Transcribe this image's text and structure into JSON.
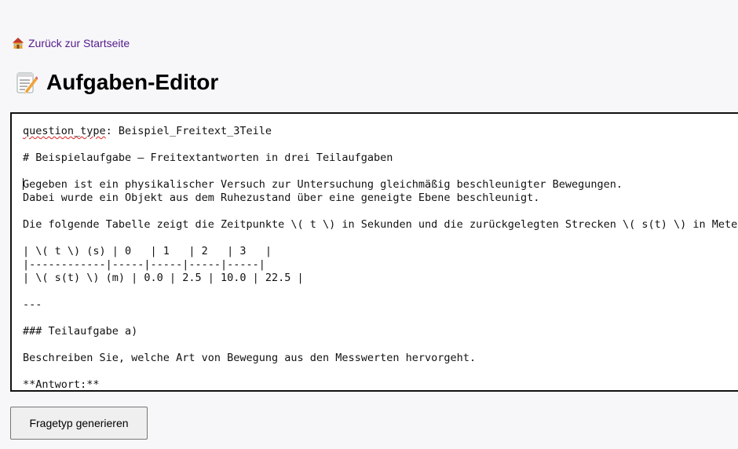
{
  "nav": {
    "back_link_label": "Zurück zur Startseite",
    "back_icon": "house-icon"
  },
  "header": {
    "title": "Aufgaben-Editor",
    "title_icon": "memo-icon"
  },
  "editor": {
    "spellcheck_flagged_word": "question_type",
    "lines": [
      "question_type: Beispiel_Freitext_3Teile",
      "",
      "# Beispielaufgabe – Freitextantworten in drei Teilaufgaben",
      "",
      "Gegeben ist ein physikalischer Versuch zur Untersuchung gleichmäßig beschleunigter Bewegungen.",
      "Dabei wurde ein Objekt aus dem Ruhezustand über eine geneigte Ebene beschleunigt.",
      "",
      "Die folgende Tabelle zeigt die Zeitpunkte \\( t \\) in Sekunden und die zurückgelegten Strecken \\( s(t) \\) in Metern:",
      "",
      "| \\( t \\) (s) | 0   | 1   | 2   | 3   |",
      "|------------|-----|-----|-----|-----|",
      "| \\( s(t) \\) (m) | 0.0 | 2.5 | 10.0 | 22.5 |",
      "",
      "---",
      "",
      "### Teilaufgabe a)",
      "",
      "Beschreiben Sie, welche Art von Bewegung aus den Messwerten hervorgeht.",
      "",
      "**Antwort:**"
    ]
  },
  "actions": {
    "generate_label": "Fragetyp generieren"
  },
  "colors": {
    "link": "#551a8b",
    "background": "#f7f7f9",
    "editor_border": "#111111"
  }
}
